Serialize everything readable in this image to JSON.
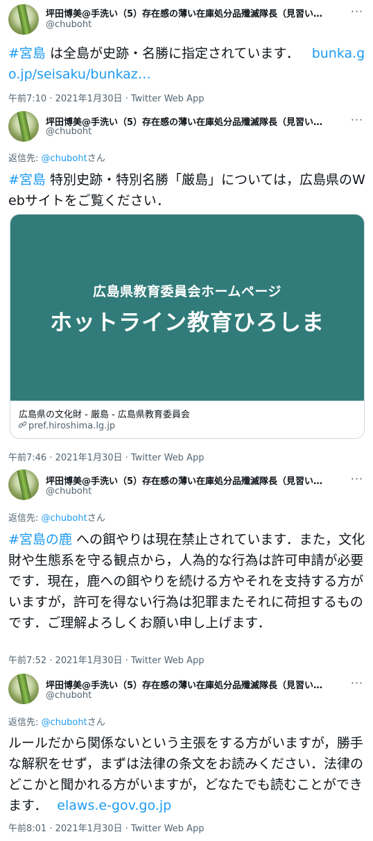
{
  "tweets": [
    {
      "name": "坪田博美@手洗い（5）存在感の薄い在庫処分品殲滅隊長（見習い…",
      "handle": "@chuboht",
      "more": "···",
      "text_parts": {
        "tag": "#宮島",
        "body": " は全島が史跡・名勝に指定されています．",
        "link": "bunka.go.jp/seisaku/bunkaz…"
      },
      "meta": "午前7:10 · 2021年1月30日 · Twitter Web App"
    },
    {
      "name": "坪田博美@手洗い（5）存在感の薄い在庫処分品殲滅隊長（見習い…",
      "handle": "@chuboht",
      "more": "···",
      "reply_prefix": "返信先: ",
      "reply_user": "@chuboht",
      "reply_suffix": "さん",
      "text_parts": {
        "tag": "#宮島",
        "body": " 特別史跡・特別名勝「厳島」については，広島県のWebサイトをご覧ください．"
      },
      "card": {
        "image_subtitle": "広島県教育委員会ホームページ",
        "image_title": "ホットライン教育ひろしま",
        "title": "広島県の文化財 - 厳島 - 広島県教育委員会",
        "domain": "pref.hiroshima.lg.jp"
      },
      "meta": "午前7:46 · 2021年1月30日 · Twitter Web App"
    },
    {
      "name": "坪田博美@手洗い（5）存在感の薄い在庫処分品殲滅隊長（見習い…",
      "handle": "@chuboht",
      "more": "···",
      "reply_prefix": "返信先: ",
      "reply_user": "@chuboht",
      "reply_suffix": "さん",
      "text_parts": {
        "tag": "#宮島の鹿",
        "body": " への餌やりは現在禁止されています．また，文化財や生態系を守る観点から，人為的な行為は許可申請が必要です．現在，鹿への餌やりを続ける方やそれを支持する方がいますが，許可を得ない行為は犯罪またそれに荷担するものです．ご理解よろしくお願い申し上げます．"
      },
      "meta": "午前7:52 · 2021年1月30日 · Twitter Web App"
    },
    {
      "name": "坪田博美@手洗い（5）存在感の薄い在庫処分品殲滅隊長（見習い…",
      "handle": "@chuboht",
      "more": "···",
      "reply_prefix": "返信先: ",
      "reply_user": "@chuboht",
      "reply_suffix": "さん",
      "text_parts": {
        "body": "ルールだから関係ないという主張をする方がいますが，勝手な解釈をせず，まずは法律の条文をお読みください．法律のどこかと聞かれる方がいますが，どなたでも読むことができます．",
        "link": "elaws.e-gov.go.jp"
      },
      "meta": "午前8:01 · 2021年1月30日 · Twitter Web App"
    }
  ],
  "colors": {
    "link": "#1d9bf0",
    "secondary": "#536471",
    "card_bg": "#317c7a"
  },
  "icons": {
    "avatar": "green-plant-avatar",
    "more": "more-options-icon",
    "link": "link-icon"
  }
}
